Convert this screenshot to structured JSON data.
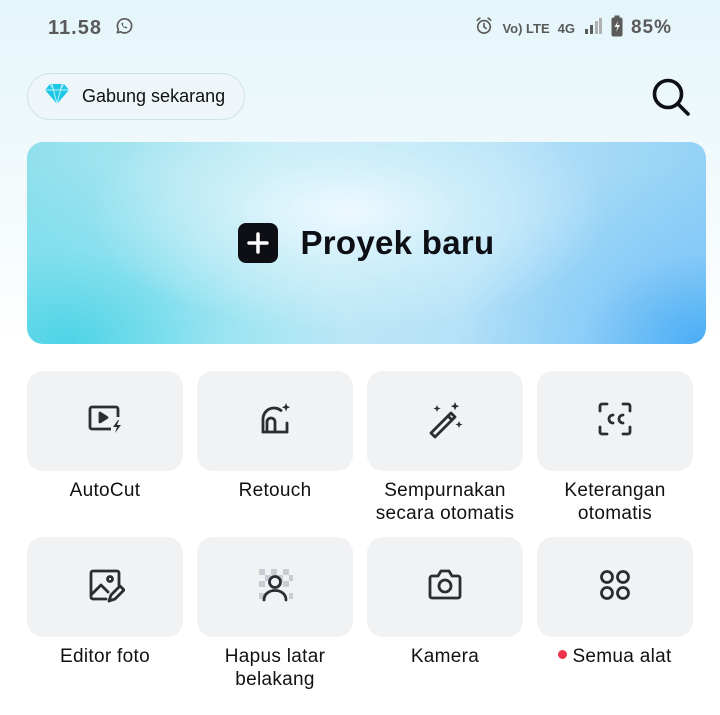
{
  "status_bar": {
    "time": "11.58",
    "volte": "Vo) LTE",
    "network": "4G",
    "battery": "85%"
  },
  "header": {
    "join_label": "Gabung sekarang",
    "join_icon": "diamond-icon",
    "search_icon": "search-icon"
  },
  "hero": {
    "label": "Proyek baru",
    "icon": "plus-icon"
  },
  "tools": [
    {
      "label": "AutoCut",
      "icon": "autocut-icon"
    },
    {
      "label": "Retouch",
      "icon": "retouch-icon"
    },
    {
      "label": "Sempurnakan secara otomatis",
      "icon": "magic-wand-icon"
    },
    {
      "label": "Keterangan otomatis",
      "icon": "captions-icon"
    },
    {
      "label": "Editor foto",
      "icon": "photo-edit-icon"
    },
    {
      "label": "Hapus latar belakang",
      "icon": "remove-background-icon"
    },
    {
      "label": "Kamera",
      "icon": "camera-icon"
    },
    {
      "label": "Semua alat",
      "icon": "all-tools-icon",
      "badge": "new-dot"
    }
  ],
  "colors": {
    "accent_dark": "#0d0f14",
    "tile_bg": "#f1f2f4",
    "badge_dot": "#f0334a",
    "diamond": "#1ec8e6"
  }
}
